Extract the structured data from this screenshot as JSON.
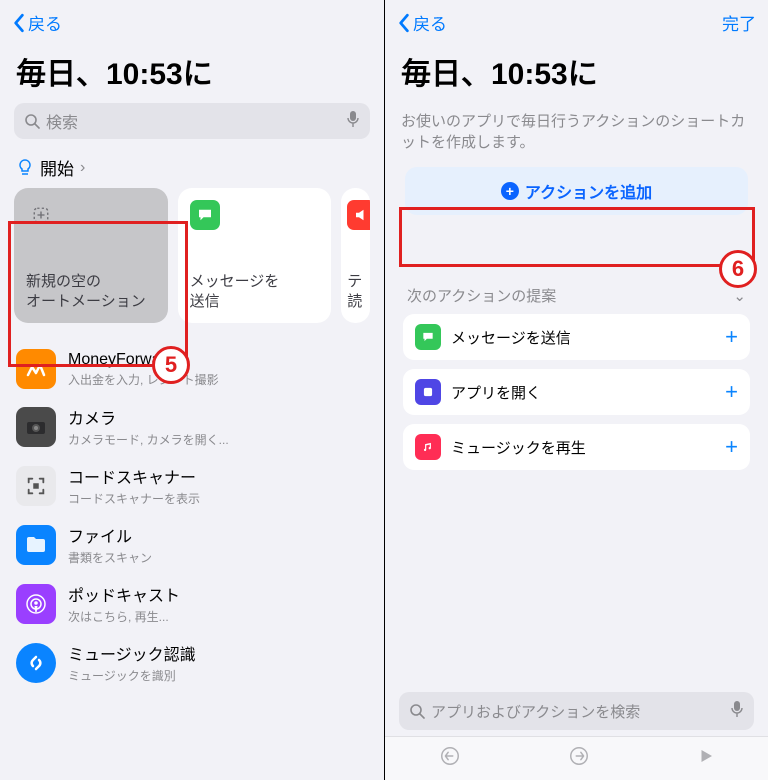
{
  "left": {
    "back": "戻る",
    "title": "毎日、10:53に",
    "search_placeholder": "検索",
    "start_label": "開始",
    "cards": [
      {
        "text": "新規の空の\nオートメーション"
      },
      {
        "text": "メッセージを\n送信"
      },
      {
        "text": "テ\n読"
      }
    ],
    "apps": [
      {
        "name": "MoneyForward",
        "sub": "入出金を入力, レシート撮影"
      },
      {
        "name": "カメラ",
        "sub": "カメラモード, カメラを開く..."
      },
      {
        "name": "コードスキャナー",
        "sub": "コードスキャナーを表示"
      },
      {
        "name": "ファイル",
        "sub": "書類をスキャン"
      },
      {
        "name": "ポッドキャスト",
        "sub": "次はこちら, 再生..."
      },
      {
        "name": "ミュージック認識",
        "sub": "ミュージックを識別"
      }
    ],
    "badge": "5"
  },
  "right": {
    "back": "戻る",
    "done": "完了",
    "title": "毎日、10:53に",
    "desc": "お使いのアプリで毎日行うアクションのショートカットを作成します。",
    "add_action": "アクションを追加",
    "sug_head": "次のアクションの提案",
    "suggestions": [
      {
        "label": "メッセージを送信"
      },
      {
        "label": "アプリを開く"
      },
      {
        "label": "ミュージックを再生"
      }
    ],
    "search_placeholder": "アプリおよびアクションを検索",
    "badge": "6"
  }
}
